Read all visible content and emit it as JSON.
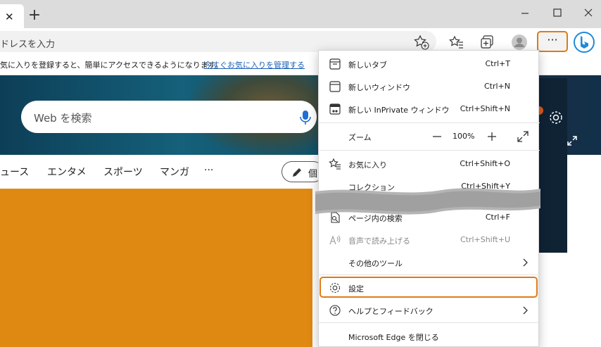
{
  "tab": {
    "close": "✕",
    "new_tab": "+"
  },
  "address": {
    "text": "ドレスを入力"
  },
  "favorites_bar": {
    "message": "気に入りを登録すると、簡単にアクセスできるようになります。",
    "link": "今すぐお気に入りを管理する"
  },
  "toolbar": {
    "more_label": "···"
  },
  "page": {
    "search_placeholder": "Web を検索",
    "nav": [
      "ュース",
      "エンタメ",
      "スポーツ",
      "マンガ",
      "···"
    ],
    "personal": "個"
  },
  "menu": {
    "new_tab": {
      "label": "新しいタブ",
      "shortcut": "Ctrl+T"
    },
    "new_window": {
      "label": "新しいウィンドウ",
      "shortcut": "Ctrl+N"
    },
    "new_inprivate": {
      "label": "新しい InPrivate ウィンドウ",
      "shortcut": "Ctrl+Shift+N"
    },
    "zoom": {
      "label": "ズーム",
      "value": "100%",
      "minus": "−",
      "plus": "+"
    },
    "favorites": {
      "label": "お気に入り",
      "shortcut": "Ctrl+Shift+O"
    },
    "collections": {
      "label": "コレクション",
      "shortcut": "Ctrl+Shift+Y"
    },
    "find": {
      "label": "ページ内の検索",
      "shortcut": "Ctrl+F"
    },
    "read_aloud": {
      "label": "音声で読み上げる",
      "shortcut": "Ctrl+Shift+U"
    },
    "more_tools": {
      "label": "その他のツール"
    },
    "settings": {
      "label": "設定"
    },
    "help": {
      "label": "ヘルプとフィードバック"
    },
    "close_edge": {
      "label": "Microsoft Edge を閉じる"
    }
  },
  "colors": {
    "highlight": "#e07a14",
    "card": "#e08912",
    "link": "#1a5fb4"
  }
}
